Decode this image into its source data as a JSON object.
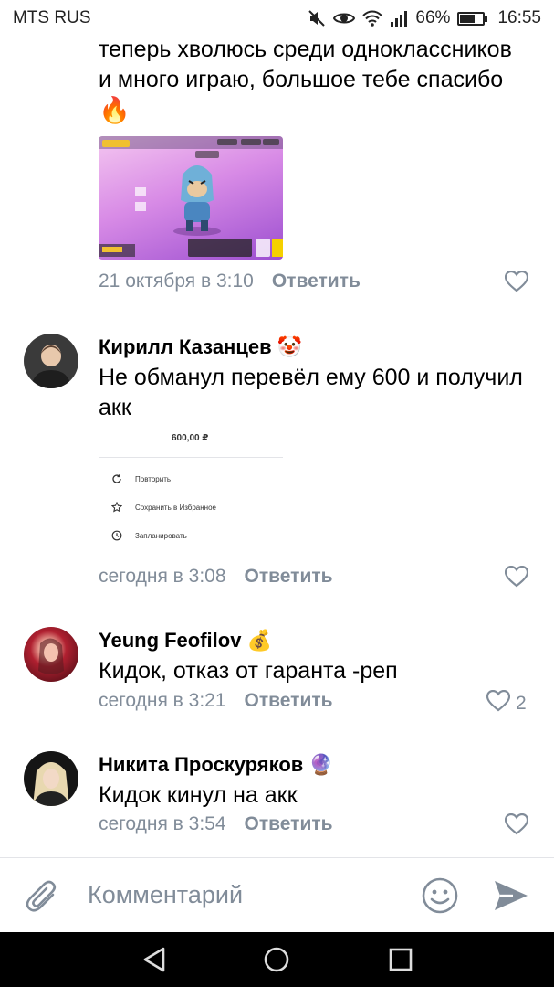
{
  "status_bar": {
    "carrier": "MTS RUS",
    "battery": "66%",
    "time": "16:55",
    "battery_level": 0.66
  },
  "comments": [
    {
      "text_lines": [
        "теперь хволюсь среди одноклассников",
        "и много играю, большое тебе спасибо"
      ],
      "emoji": "🔥",
      "date": "21 октября в 3:10",
      "reply_label": "Ответить"
    },
    {
      "author": "Кирилл Казанцев",
      "author_emoji": "🤡",
      "text_lines": [
        "Не обманул перевёл ему 600 и получил",
        "акк"
      ],
      "attachment": {
        "amount": "600,00 ₽",
        "actions": [
          "Повторить",
          "Сохранить в Избранное",
          "Запланировать"
        ]
      },
      "date": "сегодня в 3:08",
      "reply_label": "Ответить"
    },
    {
      "author": "Yeung Feofilov",
      "author_emoji": "💰",
      "text_lines": [
        "Кидок, отказ от гаранта -реп"
      ],
      "date": "сегодня в 3:21",
      "reply_label": "Ответить",
      "likes": "2"
    },
    {
      "author": "Никита Проскуряков",
      "author_emoji": "🔮",
      "text_lines": [
        "Кидок кинул на акк"
      ],
      "date": "сегодня в 3:54",
      "reply_label": "Ответить"
    }
  ],
  "comment_input": {
    "placeholder": "Комментарий"
  },
  "colors": {
    "meta": "#818c99",
    "accent": "#5181b8"
  },
  "icons": [
    "mute-icon",
    "eye-icon",
    "wifi-icon",
    "signal-icon",
    "battery-icon",
    "heart-icon",
    "attach-icon",
    "smile-icon",
    "send-icon",
    "back-icon",
    "home-icon",
    "recent-icon"
  ]
}
